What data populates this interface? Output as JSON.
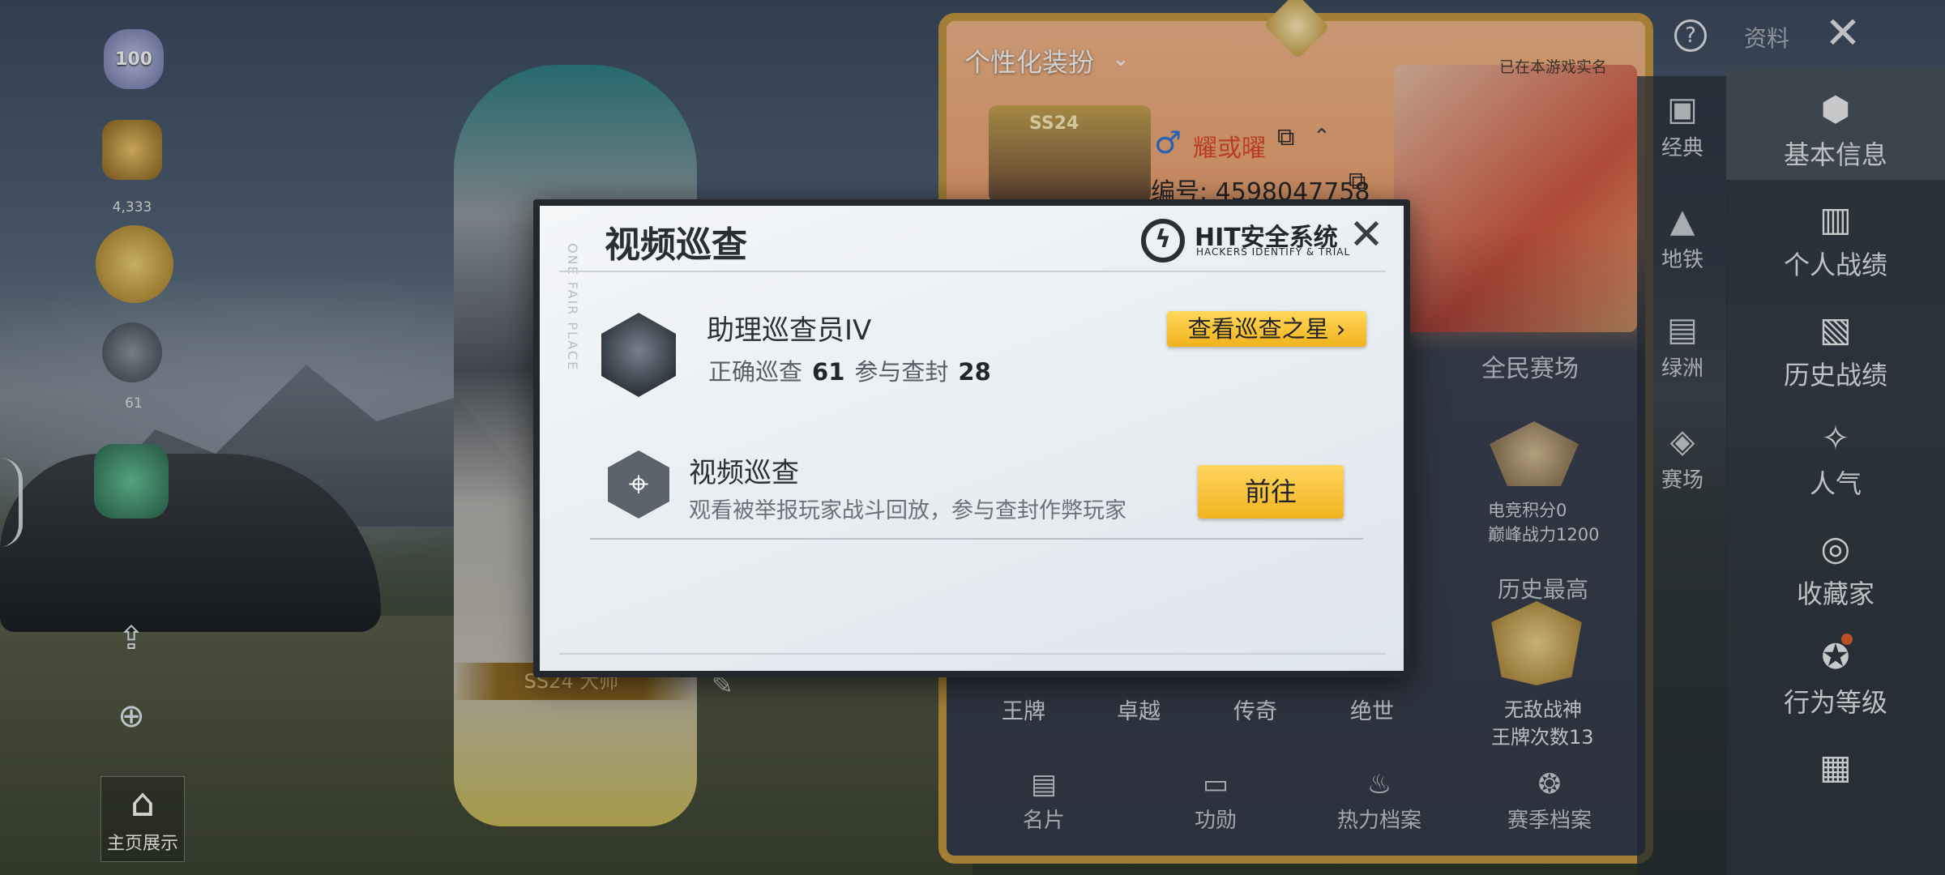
{
  "left_rail": {
    "badge_top": "100",
    "count_1": "4,333",
    "count_2": "61",
    "share_icon": "share-icon",
    "zoom_icon": "zoom-in-icon",
    "home_label": "主页展示",
    "plate_label": "SS24 大师"
  },
  "profile": {
    "outfit_label": "个性化装扮",
    "verified_text": "已在本游戏实名",
    "avatar_season": "SS24",
    "nickname": "耀或曜",
    "player_id": "编号: 4598047758",
    "mode_title": "全民赛场",
    "score": "电竞积分0",
    "peak_power": "巅峰战力1200",
    "history_title": "历史最高",
    "history_rank": "无敌战神",
    "history_count": "王牌次数13",
    "tiers": [
      "王牌",
      "卓越",
      "传奇",
      "绝世"
    ],
    "tabs": [
      "名片",
      "功勋",
      "热力档案",
      "赛季档案"
    ]
  },
  "mode_rail": {
    "items": [
      "经典",
      "地铁",
      "绿洲",
      "赛场"
    ]
  },
  "side_nav": {
    "items": [
      "基本信息",
      "个人战绩",
      "历史战绩",
      "人气",
      "收藏家",
      "行为等级",
      ""
    ],
    "top_label": "资料"
  },
  "modal": {
    "title": "视频巡查",
    "vertical_text": "ONE FAIR PLACE",
    "logo_title": "HIT安全系统",
    "logo_subtitle": "HACKERS IDENTIFY & TRIAL",
    "rank_title": "助理巡查员IV",
    "correct_label": "正确巡查",
    "correct_value": "61",
    "ban_label": "参与查封",
    "ban_value": "28",
    "star_button": "查看巡查之星 ›",
    "patrol_title": "视频巡查",
    "patrol_desc": "观看被举报玩家战斗回放，参与查封作弊玩家",
    "go_button": "前往"
  }
}
